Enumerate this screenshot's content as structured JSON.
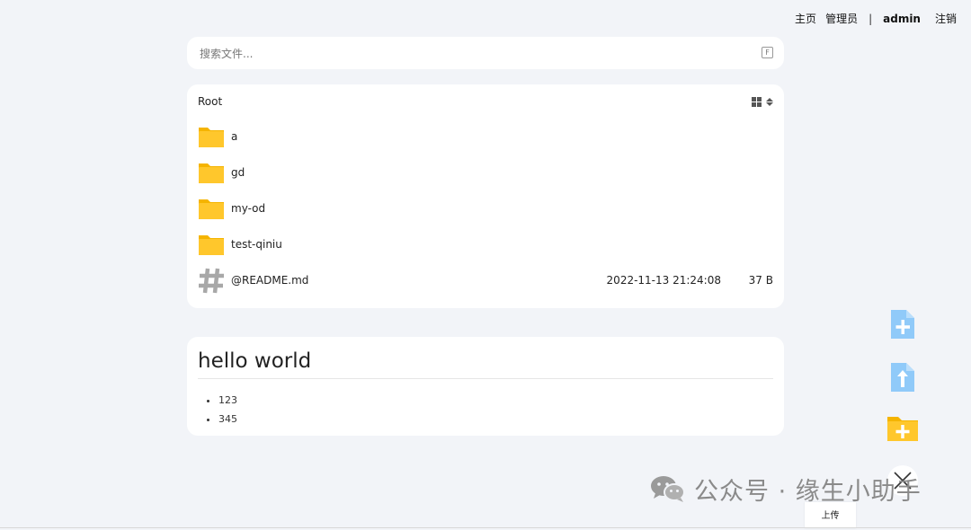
{
  "nav": {
    "home": "主页",
    "admin_role": "管理员",
    "separator": "|",
    "user": "admin",
    "logout": "注销"
  },
  "search": {
    "placeholder": "搜索文件...",
    "shortcut": "F"
  },
  "files": {
    "breadcrumb": "Root",
    "items": [
      {
        "name": "a",
        "type": "folder",
        "date": "",
        "size": ""
      },
      {
        "name": "gd",
        "type": "folder",
        "date": "",
        "size": ""
      },
      {
        "name": "my-od",
        "type": "folder",
        "date": "",
        "size": ""
      },
      {
        "name": "test-qiniu",
        "type": "folder",
        "date": "",
        "size": ""
      },
      {
        "name": "@README.md",
        "type": "markdown",
        "date": "2022-11-13 21:24:08",
        "size": "37 B"
      }
    ]
  },
  "readme": {
    "title": "hello world",
    "items": [
      "123",
      "345"
    ]
  },
  "actions": {
    "upload_tooltip": "上传"
  },
  "watermark": {
    "text": "公众号 · 缘生小助手"
  },
  "colors": {
    "background": "#f2f4f8",
    "folder": "#ffc72c",
    "file_action": "#90caf9",
    "folder_action": "#ffc72c"
  }
}
